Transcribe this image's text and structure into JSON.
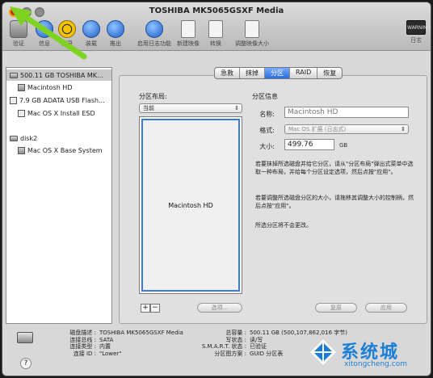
{
  "window": {
    "title": "TOSHIBA MK5065GSXF Media"
  },
  "toolbar": {
    "items": [
      {
        "label": "验证"
      },
      {
        "label": "信息"
      },
      {
        "label": "刻录"
      },
      {
        "label": "装载"
      },
      {
        "label": "推出"
      },
      {
        "label": "启用日志功能"
      },
      {
        "label": "新建映像"
      },
      {
        "label": "转换"
      },
      {
        "label": "调整映像大小"
      },
      {
        "label": "日志"
      }
    ],
    "log_icon_text": "WARNING 9:45"
  },
  "sidebar": {
    "items": [
      {
        "label": "500.11 GB TOSHIBA MK...",
        "kind": "disk",
        "selected": true
      },
      {
        "label": "Macintosh HD",
        "kind": "volume"
      },
      {
        "label": "7.9 GB ADATA USB Flash...",
        "kind": "disk"
      },
      {
        "label": "Mac OS X Install ESD",
        "kind": "volume"
      },
      {
        "label": "disk2",
        "kind": "disk"
      },
      {
        "label": "Mac OS X Base System",
        "kind": "volume"
      }
    ]
  },
  "tabs": [
    {
      "label": "急救"
    },
    {
      "label": "抹掉"
    },
    {
      "label": "分区",
      "active": true
    },
    {
      "label": "RAID"
    },
    {
      "label": "恢复"
    }
  ],
  "partition": {
    "layout_title": "分区布局:",
    "layout_value": "当前",
    "map_block_label": "Macintosh HD",
    "add": "+",
    "remove": "−",
    "options_button": "选项...",
    "info_title": "分区信息",
    "name_label": "名称:",
    "name_value": "Macintosh HD",
    "format_label": "格式:",
    "format_value": "Mac OS 扩展 (日志式)",
    "size_label": "大小:",
    "size_value": "499.76",
    "size_unit": "GB",
    "help1": "若要抹掉所选磁盘并给它分区，请从\"分区布局\"弹出式菜单中选取一种布局，并给每个分区设定选项，然后点按\"应用\"。",
    "help2": "若要调整所选磁盘分区的大小，请拖移其调整大小的控制柄，然后点按\"应用\"。",
    "help3": "所选分区将不会更改。",
    "revert_button": "复原",
    "apply_button": "应用"
  },
  "info": {
    "left_keys": [
      "磁盘描述 :",
      "连接总线 :",
      "连接类型 :",
      "连接 ID :"
    ],
    "left_vals": [
      "TOSHIBA MK5065GSXF Media",
      "SATA",
      "内置",
      "\"Lower\""
    ],
    "right_keys": [
      "总容量 :",
      "写状态 :",
      "S.M.A.R.T. 状态 :",
      "分区图方案 :"
    ],
    "right_vals": [
      "500.11 GB (500,107,862,016 字节)",
      "读/写",
      "已验证",
      "GUID 分区表"
    ],
    "help": "?"
  },
  "watermark": {
    "title": "系统城",
    "url": "xitongcheng.com"
  },
  "colors": {
    "arrow": "#7ed321",
    "accent": "#2c6ee0"
  }
}
